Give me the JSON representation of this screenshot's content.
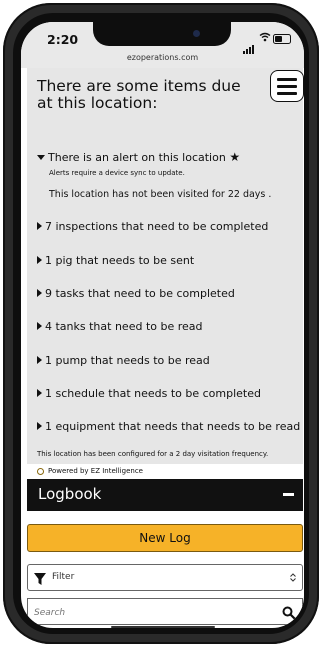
{
  "status": {
    "time": "2:20",
    "url": "ezoperations.com"
  },
  "alert": {
    "heading": "There are some items due at this location:",
    "alert_title": "There is an alert on this location",
    "sync_note": "Alerts require a device sync to update.",
    "visit_note": "This location has not been visited for 22 days .",
    "items": [
      "7 inspections that need to be completed",
      "1 pig that needs to be sent",
      "9 tasks that need to be completed",
      "4 tanks that need to be read",
      "1 pump that needs to be read",
      "1 schedule that needs to be completed",
      "1 equipment that needs that needs to be read"
    ],
    "frequency_note": "This location has been configured for a 2 day visitation frequency.",
    "powered_by": "Powered by EZ Intelligence"
  },
  "logbook": {
    "title": "Logbook",
    "new_log_label": "New Log",
    "filter_label": "Filter",
    "search_placeholder": "Search"
  },
  "colors": {
    "accent": "#f6b228",
    "panel": "#e6e6e6",
    "header_bg": "#111111"
  }
}
